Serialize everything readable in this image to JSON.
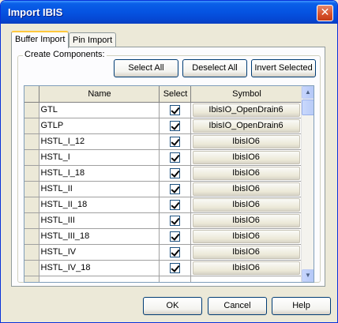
{
  "window": {
    "title": "Import IBIS",
    "close_glyph": "✕"
  },
  "tabs": [
    {
      "label": "Buffer Import",
      "active": true
    },
    {
      "label": "Pin Import",
      "active": false
    }
  ],
  "group": {
    "label": "Create Components:"
  },
  "toolbar": {
    "select_all": "Select All",
    "deselect_all": "Deselect All",
    "invert_selected": "Invert Selected"
  },
  "grid": {
    "headers": {
      "name": "Name",
      "select": "Select",
      "symbol": "Symbol"
    },
    "rows": [
      {
        "name": "GTL",
        "selected": true,
        "symbol": "IbisIO_OpenDrain6"
      },
      {
        "name": "GTLP",
        "selected": true,
        "symbol": "IbisIO_OpenDrain6"
      },
      {
        "name": "HSTL_I_12",
        "selected": true,
        "symbol": "IbisIO6"
      },
      {
        "name": "HSTL_I",
        "selected": true,
        "symbol": "IbisIO6"
      },
      {
        "name": "HSTL_I_18",
        "selected": true,
        "symbol": "IbisIO6"
      },
      {
        "name": "HSTL_II",
        "selected": true,
        "symbol": "IbisIO6"
      },
      {
        "name": "HSTL_II_18",
        "selected": true,
        "symbol": "IbisIO6"
      },
      {
        "name": "HSTL_III",
        "selected": true,
        "symbol": "IbisIO6"
      },
      {
        "name": "HSTL_III_18",
        "selected": true,
        "symbol": "IbisIO6"
      },
      {
        "name": "HSTL_IV",
        "selected": true,
        "symbol": "IbisIO6"
      },
      {
        "name": "HSTL_IV_18",
        "selected": true,
        "symbol": "IbisIO6"
      }
    ]
  },
  "scrollbar": {
    "up": "▲",
    "down": "▼"
  },
  "footer": {
    "ok": "OK",
    "cancel": "Cancel",
    "help": "Help"
  }
}
